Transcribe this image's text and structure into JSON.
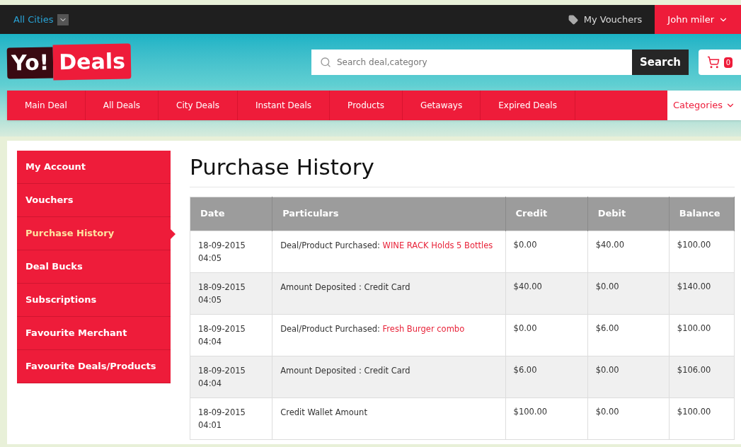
{
  "top_bar": {
    "city_selector": "All Cities",
    "vouchers_link": "My Vouchers",
    "user_menu": "John miler"
  },
  "logo": {
    "part_1": "Yo!",
    "part_2": "Deals"
  },
  "search": {
    "placeholder": "Search deal,category",
    "button": "Search"
  },
  "cart": {
    "count": "0"
  },
  "nav": {
    "items": [
      "Main Deal",
      "All Deals",
      "City Deals",
      "Instant Deals",
      "Products",
      "Getaways",
      "Expired Deals"
    ],
    "categories": "Categories"
  },
  "sidebar": {
    "items": [
      {
        "label": "My Account",
        "selected": false
      },
      {
        "label": "Vouchers",
        "selected": false
      },
      {
        "label": "Purchase History",
        "selected": true
      },
      {
        "label": "Deal Bucks",
        "selected": false
      },
      {
        "label": "Subscriptions",
        "selected": false
      },
      {
        "label": "Favourite Merchant",
        "selected": false
      },
      {
        "label": "Favourite Deals/Products",
        "selected": false
      }
    ]
  },
  "page_title": "Purchase History",
  "table": {
    "columns": [
      "Date",
      "Particulars",
      "Credit",
      "Debit",
      "Balance"
    ],
    "rows": [
      {
        "date": "18-09-2015 04:05",
        "particulars": "Deal/Product Purchased:",
        "link": "WINE RACK Holds 5 Bottles",
        "credit": "$0.00",
        "debit": "$40.00",
        "balance": "$100.00"
      },
      {
        "date": "18-09-2015 04:05",
        "particulars": "Amount Deposited : Credit Card",
        "credit": "$40.00",
        "debit": "$0.00",
        "balance": "$140.00"
      },
      {
        "date": "18-09-2015 04:04",
        "particulars": "Deal/Product Purchased:",
        "link": "Fresh Burger combo",
        "credit": "$0.00",
        "debit": "$6.00",
        "balance": "$100.00"
      },
      {
        "date": "18-09-2015 04:04",
        "particulars": "Amount Deposited : Credit Card",
        "credit": "$6.00",
        "debit": "$0.00",
        "balance": "$106.00"
      },
      {
        "date": "18-09-2015 04:01",
        "particulars": "Credit Wallet Amount",
        "credit": "$100.00",
        "debit": "$0.00",
        "balance": "$100.00"
      }
    ]
  }
}
